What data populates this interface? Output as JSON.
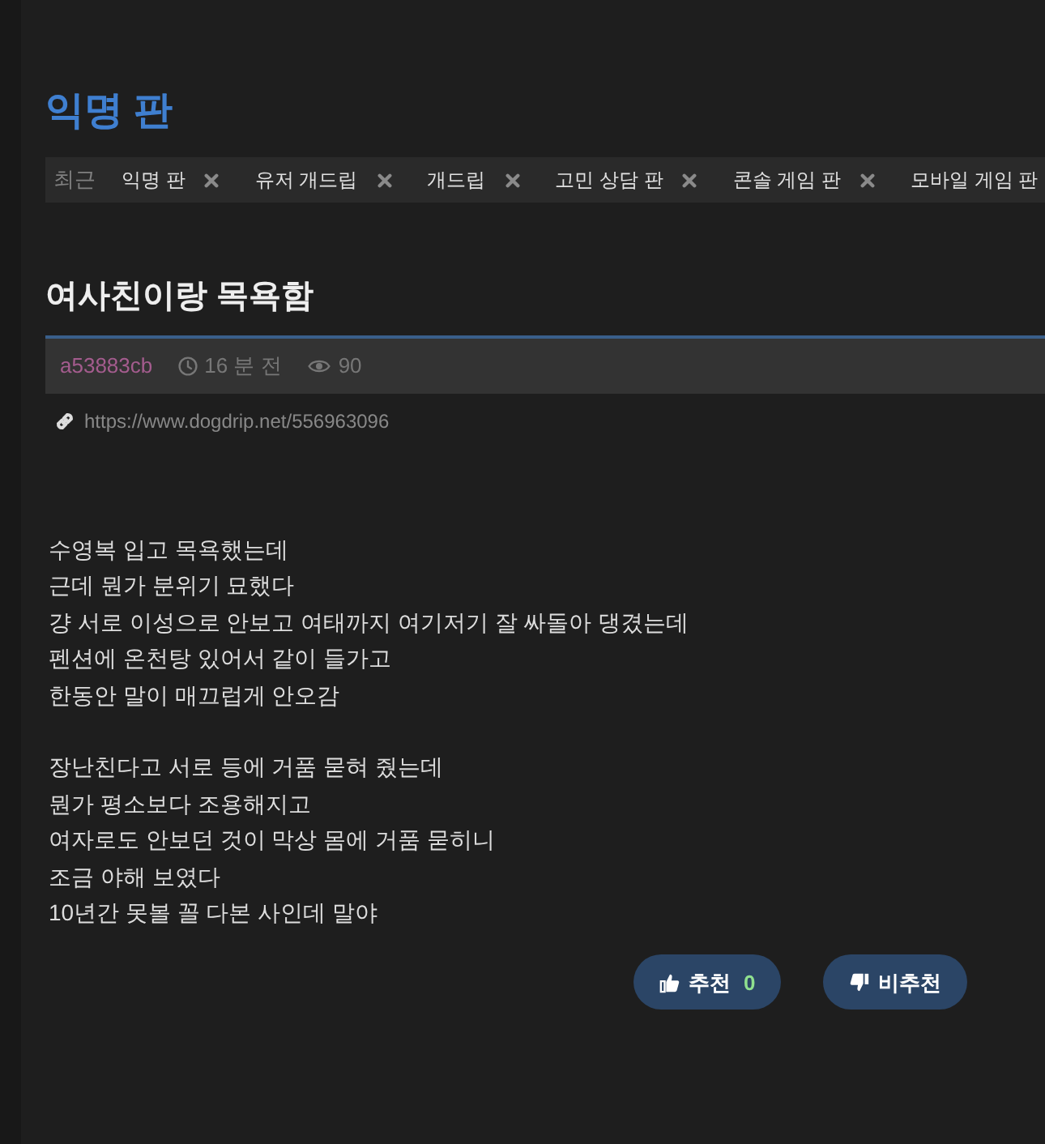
{
  "board": {
    "title": "익명 판"
  },
  "recent": {
    "label": "최근",
    "items": [
      {
        "label": "익명 판",
        "closable": true
      },
      {
        "label": "유저 개드립",
        "closable": true
      },
      {
        "label": "개드립",
        "closable": true
      },
      {
        "label": "고민 상담 판",
        "closable": true
      },
      {
        "label": "콘솔 게임 판",
        "closable": true
      },
      {
        "label": "모바일 게임 판",
        "closable": false
      }
    ]
  },
  "post": {
    "title": "여사친이랑 목욕함",
    "author": "a53883cb",
    "time": "16 분 전",
    "views": "90",
    "url": "https://www.dogdrip.net/556963096",
    "paragraphs": [
      [
        "수영복 입고 목욕했는데",
        "근데 뭔가 분위기 묘했다",
        "걍 서로 이성으로 안보고 여태까지 여기저기 잘 싸돌아 댕겼는데",
        "펜션에 온천탕 있어서 같이 들가고",
        "한동안 말이 매끄럽게 안오감"
      ],
      [
        "장난친다고 서로 등에 거품 묻혀 줬는데",
        "뭔가 평소보다 조용해지고",
        "여자로도 안보던 것이 막상 몸에 거품 묻히니",
        "조금 야해 보였다",
        "10년간 못볼 꼴 다본 사인데 말야"
      ]
    ]
  },
  "votes": [
    {
      "kind": "up",
      "label": "추천",
      "count": "0"
    },
    {
      "kind": "down",
      "label": "비추천"
    }
  ]
}
